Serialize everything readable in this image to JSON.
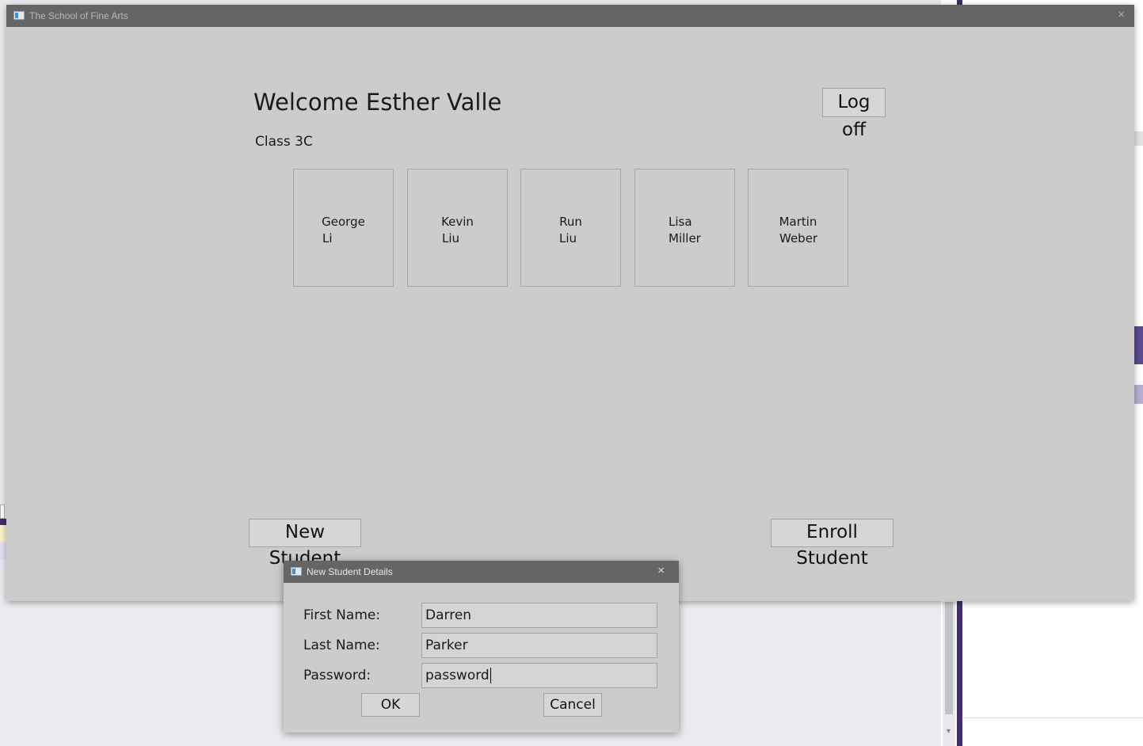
{
  "main_window": {
    "title": "The School of Fine Arts",
    "close_glyph": "×",
    "welcome": "Welcome Esther Valle",
    "logoff_label": "Log off",
    "class_label": "Class 3C",
    "students": [
      {
        "first": "George",
        "last": "Li"
      },
      {
        "first": "Kevin",
        "last": "Liu"
      },
      {
        "first": "Run",
        "last": "Liu"
      },
      {
        "first": "Lisa",
        "last": "Miller"
      },
      {
        "first": "Martin",
        "last": "Weber"
      }
    ],
    "new_student_label": "New Student",
    "enroll_student_label": "Enroll Student"
  },
  "dialog": {
    "title": "New Student Details",
    "close_glyph": "×",
    "first_name_label": "First Name:",
    "first_name_value": "Darren",
    "last_name_label": "Last Name:",
    "last_name_value": "Parker",
    "password_label": "Password:",
    "password_value": "password",
    "ok_label": "OK",
    "cancel_label": "Cancel"
  },
  "icons": {
    "window_icon": "app-window-icon",
    "close_icon": "close-icon",
    "scroll_arrow": "chevron-down-icon"
  }
}
